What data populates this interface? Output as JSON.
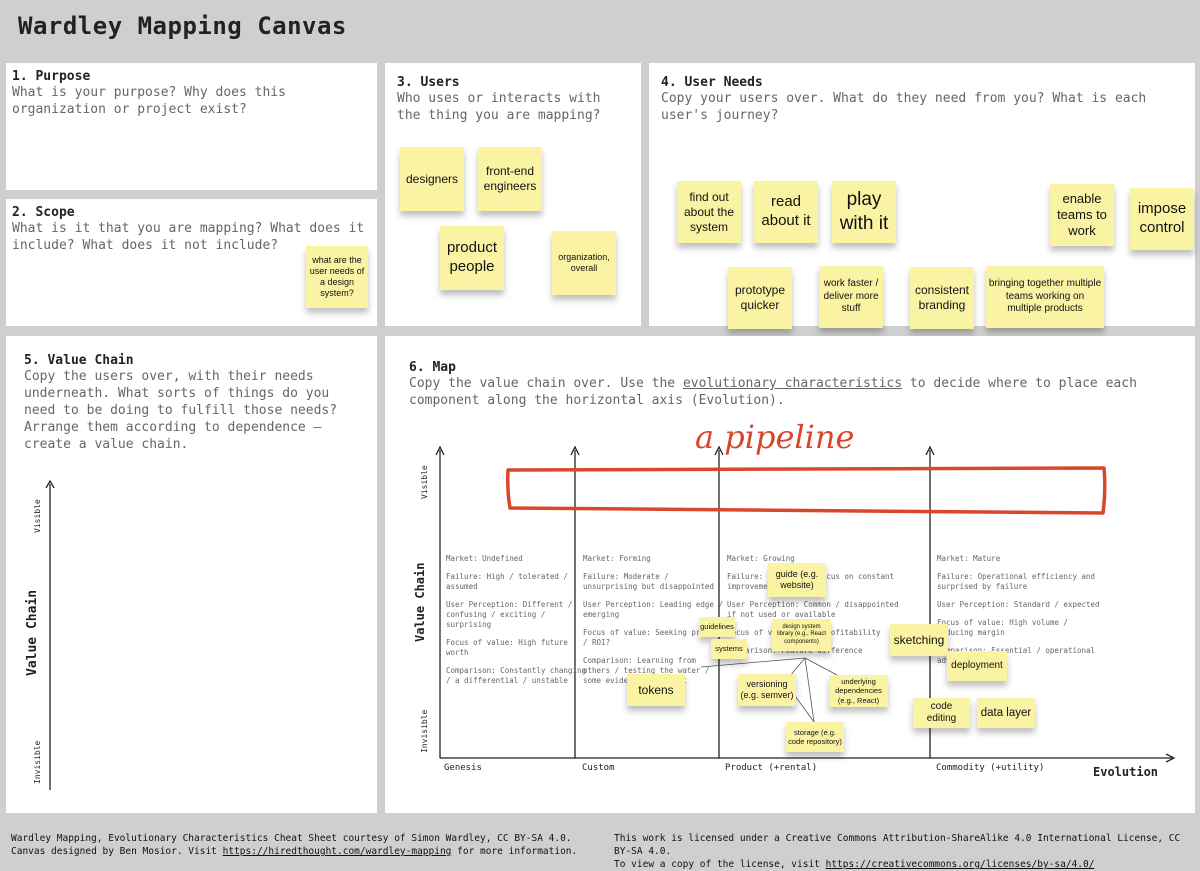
{
  "title": "Wardley Mapping Canvas",
  "purpose": {
    "title": "1. Purpose",
    "desc": "What is your purpose? Why does this organization or project exist?"
  },
  "scope": {
    "title": "2. Scope",
    "desc": "What is it that you are mapping? What does it include? What does it not include?",
    "note": "what are the user needs of a design system?"
  },
  "users": {
    "title": "3. Users",
    "desc": "Who uses or interacts with the thing you are mapping?",
    "notes": [
      "designers",
      "front-end engineers",
      "product people",
      "organization, overall"
    ]
  },
  "needs": {
    "title": "4. User Needs",
    "desc": "Copy your users over. What do they need from you? What is each user's journey?",
    "notes": [
      "find out about the system",
      "read about it",
      "play with it",
      "enable teams to work",
      "impose control",
      "prototype quicker",
      "work faster / deliver more stuff",
      "consistent branding",
      "bringing together multiple teams working on multiple products"
    ]
  },
  "valuechain": {
    "title": "5. Value Chain",
    "desc": "Copy the users over, with their needs underneath. What sorts of things do you need to be doing to fulfill those needs? Arrange them according to dependence — create a value chain.",
    "axis": "Value Chain",
    "visible": "Visible",
    "invisible": "Invisible"
  },
  "map": {
    "title": "6. Map",
    "desc_before": "Copy the value chain over. Use the ",
    "desc_link": "evolutionary characteristics",
    "desc_after": " to decide where to place each component along the horizontal axis (Evolution).",
    "annotation": "a pipeline",
    "yaxis": "Value Chain",
    "visible": "Visible",
    "invisible": "Invisible",
    "xaxis": "Evolution",
    "stages": [
      "Genesis",
      "Custom",
      "Product (+rental)",
      "Commodity (+utility)"
    ],
    "columns": [
      [
        "Market: Undefined",
        "Failure: High / tolerated / assumed",
        "User Perception: Different / confusing / exciting / surprising",
        "Focus of value: High future worth",
        "Comparison: Constantly changing / a differential / unstable"
      ],
      [
        "Market: Forming",
        "Failure: Moderate / unsurprising but disappointed",
        "User Perception: Leading edge / emerging",
        "Focus of value: Seeking profit / ROI?",
        "Comparison: Learning from others / testing the water / some evidential support"
      ],
      [
        "Market: Growing",
        "Failure: Reducing / focus on constant improvement",
        "User Perception: Common / disappointed if not used or available",
        "Focus of value: High profitability",
        "Comparison: Feature difference"
      ],
      [
        "Market: Mature",
        "Failure: Operational efficiency and surprised by failure",
        "User Perception: Standard / expected",
        "Focus of value: High volume / reducing margin",
        "Comparison: Essential / operational advantage"
      ]
    ],
    "components": [
      "guide (e.g. website)",
      "guidelines",
      "design system library (e.g., React components)",
      "systems",
      "sketching",
      "deployment",
      "tokens",
      "versioning (e.g. semver)",
      "underlying dependencies (e.g., React)",
      "code editing",
      "data layer",
      "storage (e.g. code repository)"
    ]
  },
  "footer": {
    "left1": "Wardley Mapping, Evolutionary Characteristics Cheat Sheet courtesy of Simon Wardley, CC BY-SA 4.0.",
    "left2a": "Canvas designed by Ben Mosior. Visit ",
    "left2link": "https://hiredthought.com/wardley-mapping",
    "left2b": " for more information.",
    "right1": "This work is licensed under a Creative Commons Attribution-ShareAlike 4.0 International License, CC BY-SA 4.0.",
    "right2a": "To view a copy of the license, visit ",
    "right2link": "https://creativecommons.org/licenses/by-sa/4.0/"
  },
  "colors": {
    "sticky": "#fbf3a4",
    "annotation": "#d9462b",
    "background": "#cfcfcf"
  }
}
